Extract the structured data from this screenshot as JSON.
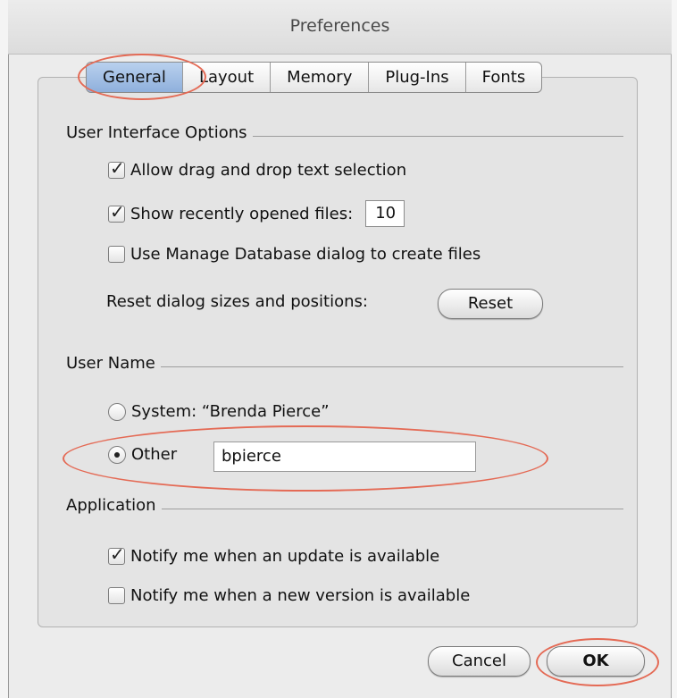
{
  "window": {
    "title": "Preferences"
  },
  "tabs": [
    "General",
    "Layout",
    "Memory",
    "Plug-Ins",
    "Fonts"
  ],
  "selected_tab": "General",
  "ui_options": {
    "heading": "User Interface Options",
    "drag_drop_label": "Allow drag and drop text selection",
    "drag_drop_checked": true,
    "recent_files_label": "Show recently opened files:",
    "recent_files_checked": true,
    "recent_files_count": "10",
    "manage_db_label": "Use Manage Database dialog to create files",
    "manage_db_checked": false,
    "reset_label": "Reset dialog sizes and positions:",
    "reset_button": "Reset"
  },
  "user_name": {
    "heading": "User Name",
    "system_label": "System: “Brenda Pierce”",
    "other_label": "Other",
    "other_value": "bpierce",
    "selected": "other"
  },
  "application": {
    "heading": "Application",
    "update_label": "Notify me when an update is available",
    "update_checked": true,
    "version_label": "Notify me when a new version is available",
    "version_checked": false
  },
  "buttons": {
    "cancel": "Cancel",
    "ok": "OK"
  },
  "highlight_color": "#e46a55"
}
